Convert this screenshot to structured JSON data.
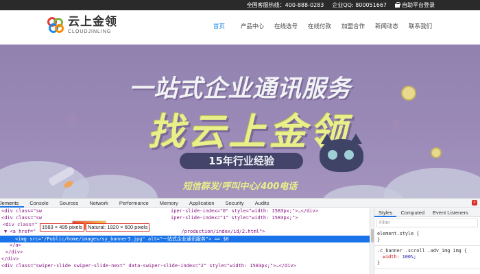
{
  "topbar": {
    "hotline": "全国客服热线：400-888-0283",
    "qq": "企业QQ: 800051667",
    "login": "自助平台登录"
  },
  "header": {
    "logo_cn": "云上金领",
    "logo_en": "CLOUDJINLING",
    "nav": [
      "首页",
      "产品中心",
      "在线选号",
      "在线付款",
      "加盟合作",
      "新闻动态",
      "联系我们"
    ],
    "active_index": 0,
    "accent_color": "#1e88e5"
  },
  "banner": {
    "headline1": "一站式企业通讯服务",
    "headline2": "找云上金领",
    "pill": "15年行业经验",
    "subline": "短信群发/呼叫中心/400电话"
  },
  "devtools": {
    "tabs": [
      "Elements",
      "Console",
      "Sources",
      "Network",
      "Performance",
      "Memory",
      "Application",
      "Security",
      "Audits"
    ],
    "active_tab": "Elements",
    "tooltip_size": "1583 × 495 pixels",
    "tooltip_natural": "Natural: 1920 × 600 pixels",
    "code": [
      {
        "prefix": "<div class=\"sw",
        "rest": "iper-slide-index=\"0\" style=\"width: 1583px;\">…</div>"
      },
      {
        "prefix": "<div class=\"sw",
        "rest": "iper-slide-index=\"1\" style=\"width: 1583px;\">"
      },
      {
        "prefix": "<div class=\"",
        "rest": ""
      },
      {
        "prefix": "▼ <a href=\"",
        "rest": "/production/index/id/2.html\">"
      },
      {
        "prefix": "<img src=\"/Public/home/images/sy_banner3.jpg\" alt=\"一站式企业通讯服务\"> == $0",
        "rest": ""
      },
      {
        "prefix": "</a>",
        "rest": ""
      },
      {
        "prefix": "</div>",
        "rest": ""
      },
      {
        "prefix": "</div>",
        "rest": ""
      },
      {
        "prefix": "<div class=\"swiper-slide swiper-slide-next\" data-swiper-slide-index=\"2\" style=\"width: 1583px;\">…</div>",
        "rest": ""
      }
    ],
    "styles": {
      "tabs": [
        "Styles",
        "Computed",
        "Event Listeners"
      ],
      "filter_placeholder": "Filter",
      "rule1_selector": "element.style {",
      "rule1_close": "}",
      "rule2_selector": ".c_banner .scroll .adv_img img {",
      "rule2_prop": "width:",
      "rule2_val": "100%;",
      "rule2_close": "}"
    }
  }
}
